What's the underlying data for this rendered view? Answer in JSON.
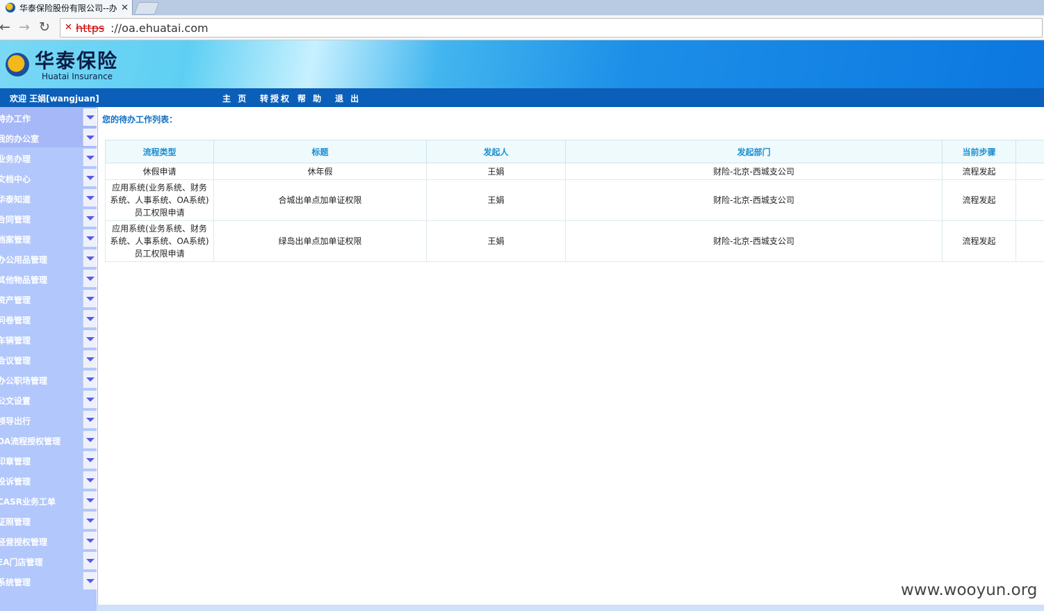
{
  "browser": {
    "tab_title": "华泰保险股份有限公司--办",
    "url_scheme": "https",
    "url_rest": "://oa.ehuatai.com"
  },
  "header": {
    "logo_cn": "华泰保险",
    "logo_en": "Huatai Insurance"
  },
  "menubar": {
    "welcome": "欢迎 王娟[wangjuan]",
    "items": [
      "主 页",
      "转授权",
      "帮 助",
      "退 出"
    ]
  },
  "sidebar": {
    "items": [
      "待办工作",
      "我的办公室",
      "业务办理",
      "文档中心",
      "华泰知道",
      "合同管理",
      "档案管理",
      "办公用品管理",
      "其他物品管理",
      "资产管理",
      "问卷管理",
      "车辆管理",
      "会议管理",
      "办公职场管理",
      "公文设置",
      "领导出行",
      "OA流程授权管理",
      "印章管理",
      "投诉管理",
      "CASR业务工单",
      "证照管理",
      "经营授权管理",
      "EA门店管理",
      "系统管理"
    ]
  },
  "main": {
    "list_title": "您的待办工作列表：",
    "columns": [
      "流程类型",
      "标题",
      "发起人",
      "发起部门",
      "当前步骤",
      ""
    ],
    "rows": [
      [
        "休假申请",
        "休年假",
        "王娟",
        "财险-北京-西城支公司",
        "流程发起",
        ""
      ],
      [
        "应用系统(业务系统、财务系统、人事系统、OA系统)员工权限申请",
        "合城出单点加单证权限",
        "王娟",
        "财险-北京-西城支公司",
        "流程发起",
        ""
      ],
      [
        "应用系统(业务系统、财务系统、人事系统、OA系统)员工权限申请",
        "绿岛出单点加单证权限",
        "王娟",
        "财险-北京-西城支公司",
        "流程发起",
        ""
      ]
    ]
  },
  "watermark": "www.wooyun.org"
}
